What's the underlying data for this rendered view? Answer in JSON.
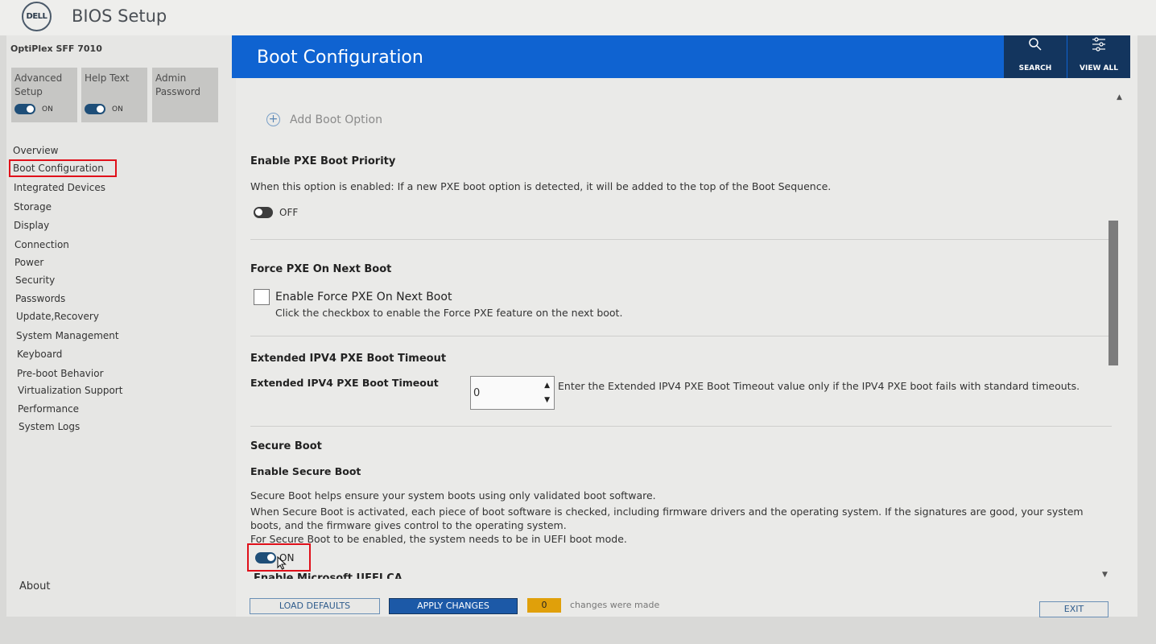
{
  "app": {
    "logo": "DELL",
    "title": "BIOS Setup"
  },
  "sidebar": {
    "model": "OptiPlex SFF 7010",
    "tiles": [
      {
        "label": "Advanced Setup",
        "toggle": "ON"
      },
      {
        "label": "Help Text",
        "toggle": "ON"
      },
      {
        "label": "Admin Password"
      }
    ],
    "items": [
      {
        "label": "Overview"
      },
      {
        "label": "Boot Configuration"
      },
      {
        "label": "Integrated Devices"
      },
      {
        "label": "Storage"
      },
      {
        "label": "Display"
      },
      {
        "label": "Connection"
      },
      {
        "label": "Power"
      },
      {
        "label": "Security"
      },
      {
        "label": "Passwords"
      },
      {
        "label": "Update,Recovery"
      },
      {
        "label": "System Management"
      },
      {
        "label": "Keyboard"
      },
      {
        "label": "Pre-boot Behavior"
      },
      {
        "label": "Virtualization Support"
      },
      {
        "label": "Performance"
      },
      {
        "label": "System Logs"
      }
    ],
    "about": "About"
  },
  "header": {
    "title": "Boot Configuration",
    "search_label": "SEARCH",
    "view_all_label": "VIEW ALL"
  },
  "content": {
    "add_boot_option": "Add Boot Option",
    "pxe_priority": {
      "title": "Enable PXE Boot Priority",
      "desc": "When this option is enabled: If a new PXE boot option is detected, it will be added to the top of the Boot Sequence.",
      "state": "OFF"
    },
    "force_pxe": {
      "title": "Force PXE On Next Boot",
      "checkbox_label": "Enable Force PXE On Next Boot",
      "checkbox_desc": "Click the checkbox to enable the Force PXE feature on the next boot."
    },
    "ipv4_timeout": {
      "title": "Extended IPV4 PXE Boot Timeout",
      "field_label": "Extended IPV4 PXE Boot Timeout",
      "value": "0",
      "desc": "Enter the Extended IPV4 PXE Boot Timeout value only if the IPV4 PXE boot fails with standard timeouts."
    },
    "secure_boot": {
      "title": "Secure Boot",
      "subtitle": "Enable Secure Boot",
      "desc1": "Secure Boot helps ensure your system boots using only validated boot software.",
      "desc2": "When Secure Boot is activated, each piece of boot software is checked, including firmware drivers and the operating system. If the signatures are good, your system boots, and the firmware gives control to the operating system.",
      "desc3": "For Secure Boot to be enabled, the system needs to be in UEFI boot mode.",
      "state": "ON"
    },
    "next_partial": "Enable Microsoft UEFI CA"
  },
  "footer": {
    "load_defaults": "LOAD DEFAULTS",
    "apply_changes": "APPLY CHANGES",
    "change_count": "0",
    "changes_text": "changes were made",
    "exit": "EXIT"
  },
  "colors": {
    "header_blue": "#0f63d1",
    "header_button": "#13355e",
    "highlight_red": "#e0101a",
    "count_badge": "#e0a00a"
  }
}
